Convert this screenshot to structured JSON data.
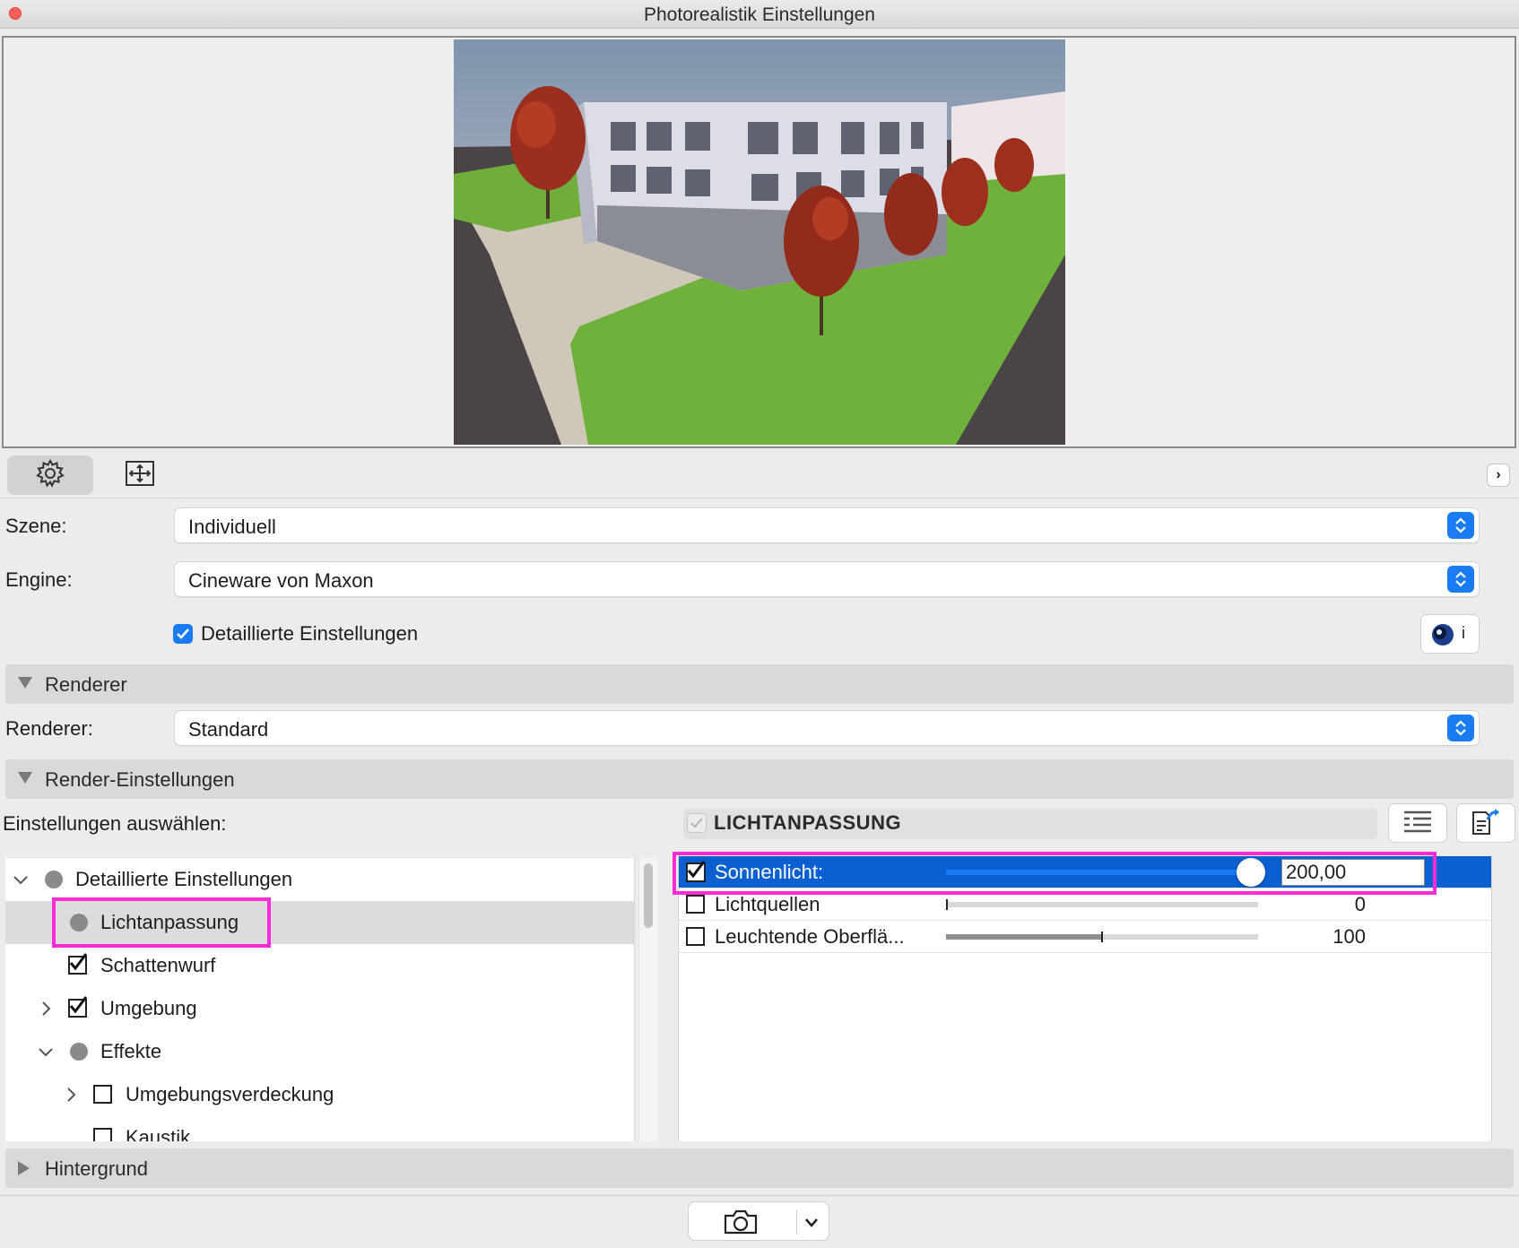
{
  "window": {
    "title": "Photorealistik Einstellungen"
  },
  "toolbar": {
    "settings_icon": "gear-icon",
    "view_icon": "frame-icon",
    "expand_icon": "chevron-right-icon"
  },
  "scene": {
    "label": "Szene:",
    "value": "Individuell"
  },
  "engine": {
    "label": "Engine:",
    "value": "Cineware von Maxon"
  },
  "detailed": {
    "label": "Detaillierte Einstellungen",
    "checked": true
  },
  "info_button": {
    "icon": "cinema4d-logo-icon",
    "text": "i"
  },
  "sections": {
    "renderer": "Renderer",
    "render_settings": "Render-Einstellungen",
    "background": "Hintergrund"
  },
  "renderer": {
    "label": "Renderer:",
    "value": "Standard"
  },
  "select_label": "Einstellungen auswählen:",
  "tree": {
    "root": "Detaillierte Einstellungen",
    "items": [
      {
        "label": "Lichtanpassung",
        "state": "dot",
        "selected": true
      },
      {
        "label": "Schattenwurf",
        "state": "checked"
      },
      {
        "label": "Umgebung",
        "state": "checked"
      },
      {
        "label": "Effekte",
        "state": "dot"
      },
      {
        "label": "Umgebungsverdeckung",
        "state": "unchecked"
      },
      {
        "label": "Kaustik",
        "state": "unchecked"
      }
    ]
  },
  "panel": {
    "title": "LICHTANPASSUNG",
    "list_icon": "list-tree-icon",
    "export_icon": "export-doc-icon",
    "rows": [
      {
        "name": "Sonnenlicht:",
        "checked": true,
        "value": "200,00",
        "level": 1.0
      },
      {
        "name": "Lichtquellen",
        "checked": false,
        "value": "0",
        "level": 0.0
      },
      {
        "name": "Leuchtende Oberflä...",
        "checked": false,
        "value": "100",
        "level": 0.5
      }
    ]
  },
  "bottom": {
    "camera_icon": "camera-icon",
    "dropdown_icon": "chevron-down-icon"
  },
  "colors": {
    "accent": "#1a7cf4",
    "selection": "#0a5fd1",
    "highlight": "#ff2bd6"
  }
}
